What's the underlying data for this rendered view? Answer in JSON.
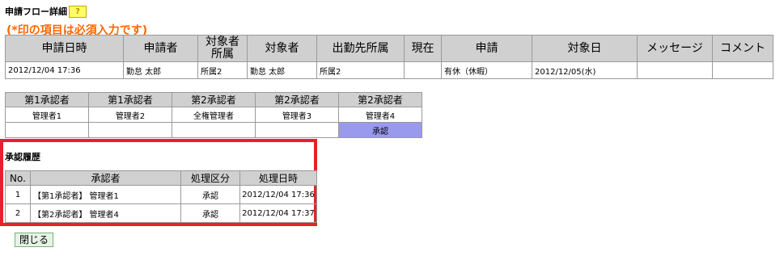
{
  "page": {
    "title": "申請フロー詳細",
    "help_label": "?",
    "required_note": "(*印の項目は必須入力です)"
  },
  "main_table": {
    "headers": [
      "申請日時",
      "申請者",
      "対象者\n所属",
      "対象者",
      "出勤先所属",
      "現在",
      "申請",
      "対象日",
      "メッセージ",
      "コメント"
    ],
    "row": [
      "2012/12/04 17:36",
      "勤怠 太郎",
      "所属2",
      "勤怠 太郎",
      "所属2",
      "",
      "有休（休暇）",
      "2012/12/05(水)",
      "",
      ""
    ]
  },
  "approver_table": {
    "headers": [
      "第1承認者",
      "第1承認者",
      "第2承認者",
      "第2承認者",
      "第2承認者"
    ],
    "names": [
      "管理者1",
      "管理者2",
      "全権管理者",
      "管理者3",
      "管理者4"
    ],
    "status": [
      "",
      "",
      "",
      "",
      "承認"
    ]
  },
  "history": {
    "title": "承認履歴",
    "headers": [
      "No.",
      "承認者",
      "処理区分",
      "処理日時"
    ],
    "rows": [
      [
        "1",
        "【第1承認者】 管理者1",
        "承認",
        "2012/12/04 17:36"
      ],
      [
        "2",
        "【第2承認者】 管理者4",
        "承認",
        "2012/12/04 17:37"
      ]
    ]
  },
  "buttons": {
    "close_label": "閉じる"
  },
  "colors": {
    "accent_orange": "#ff6600",
    "highlight_red": "#e8202a",
    "approved_cell": "#9999ee",
    "header_gray": "#d0d0d0",
    "help_yellow": "#ffff66"
  }
}
